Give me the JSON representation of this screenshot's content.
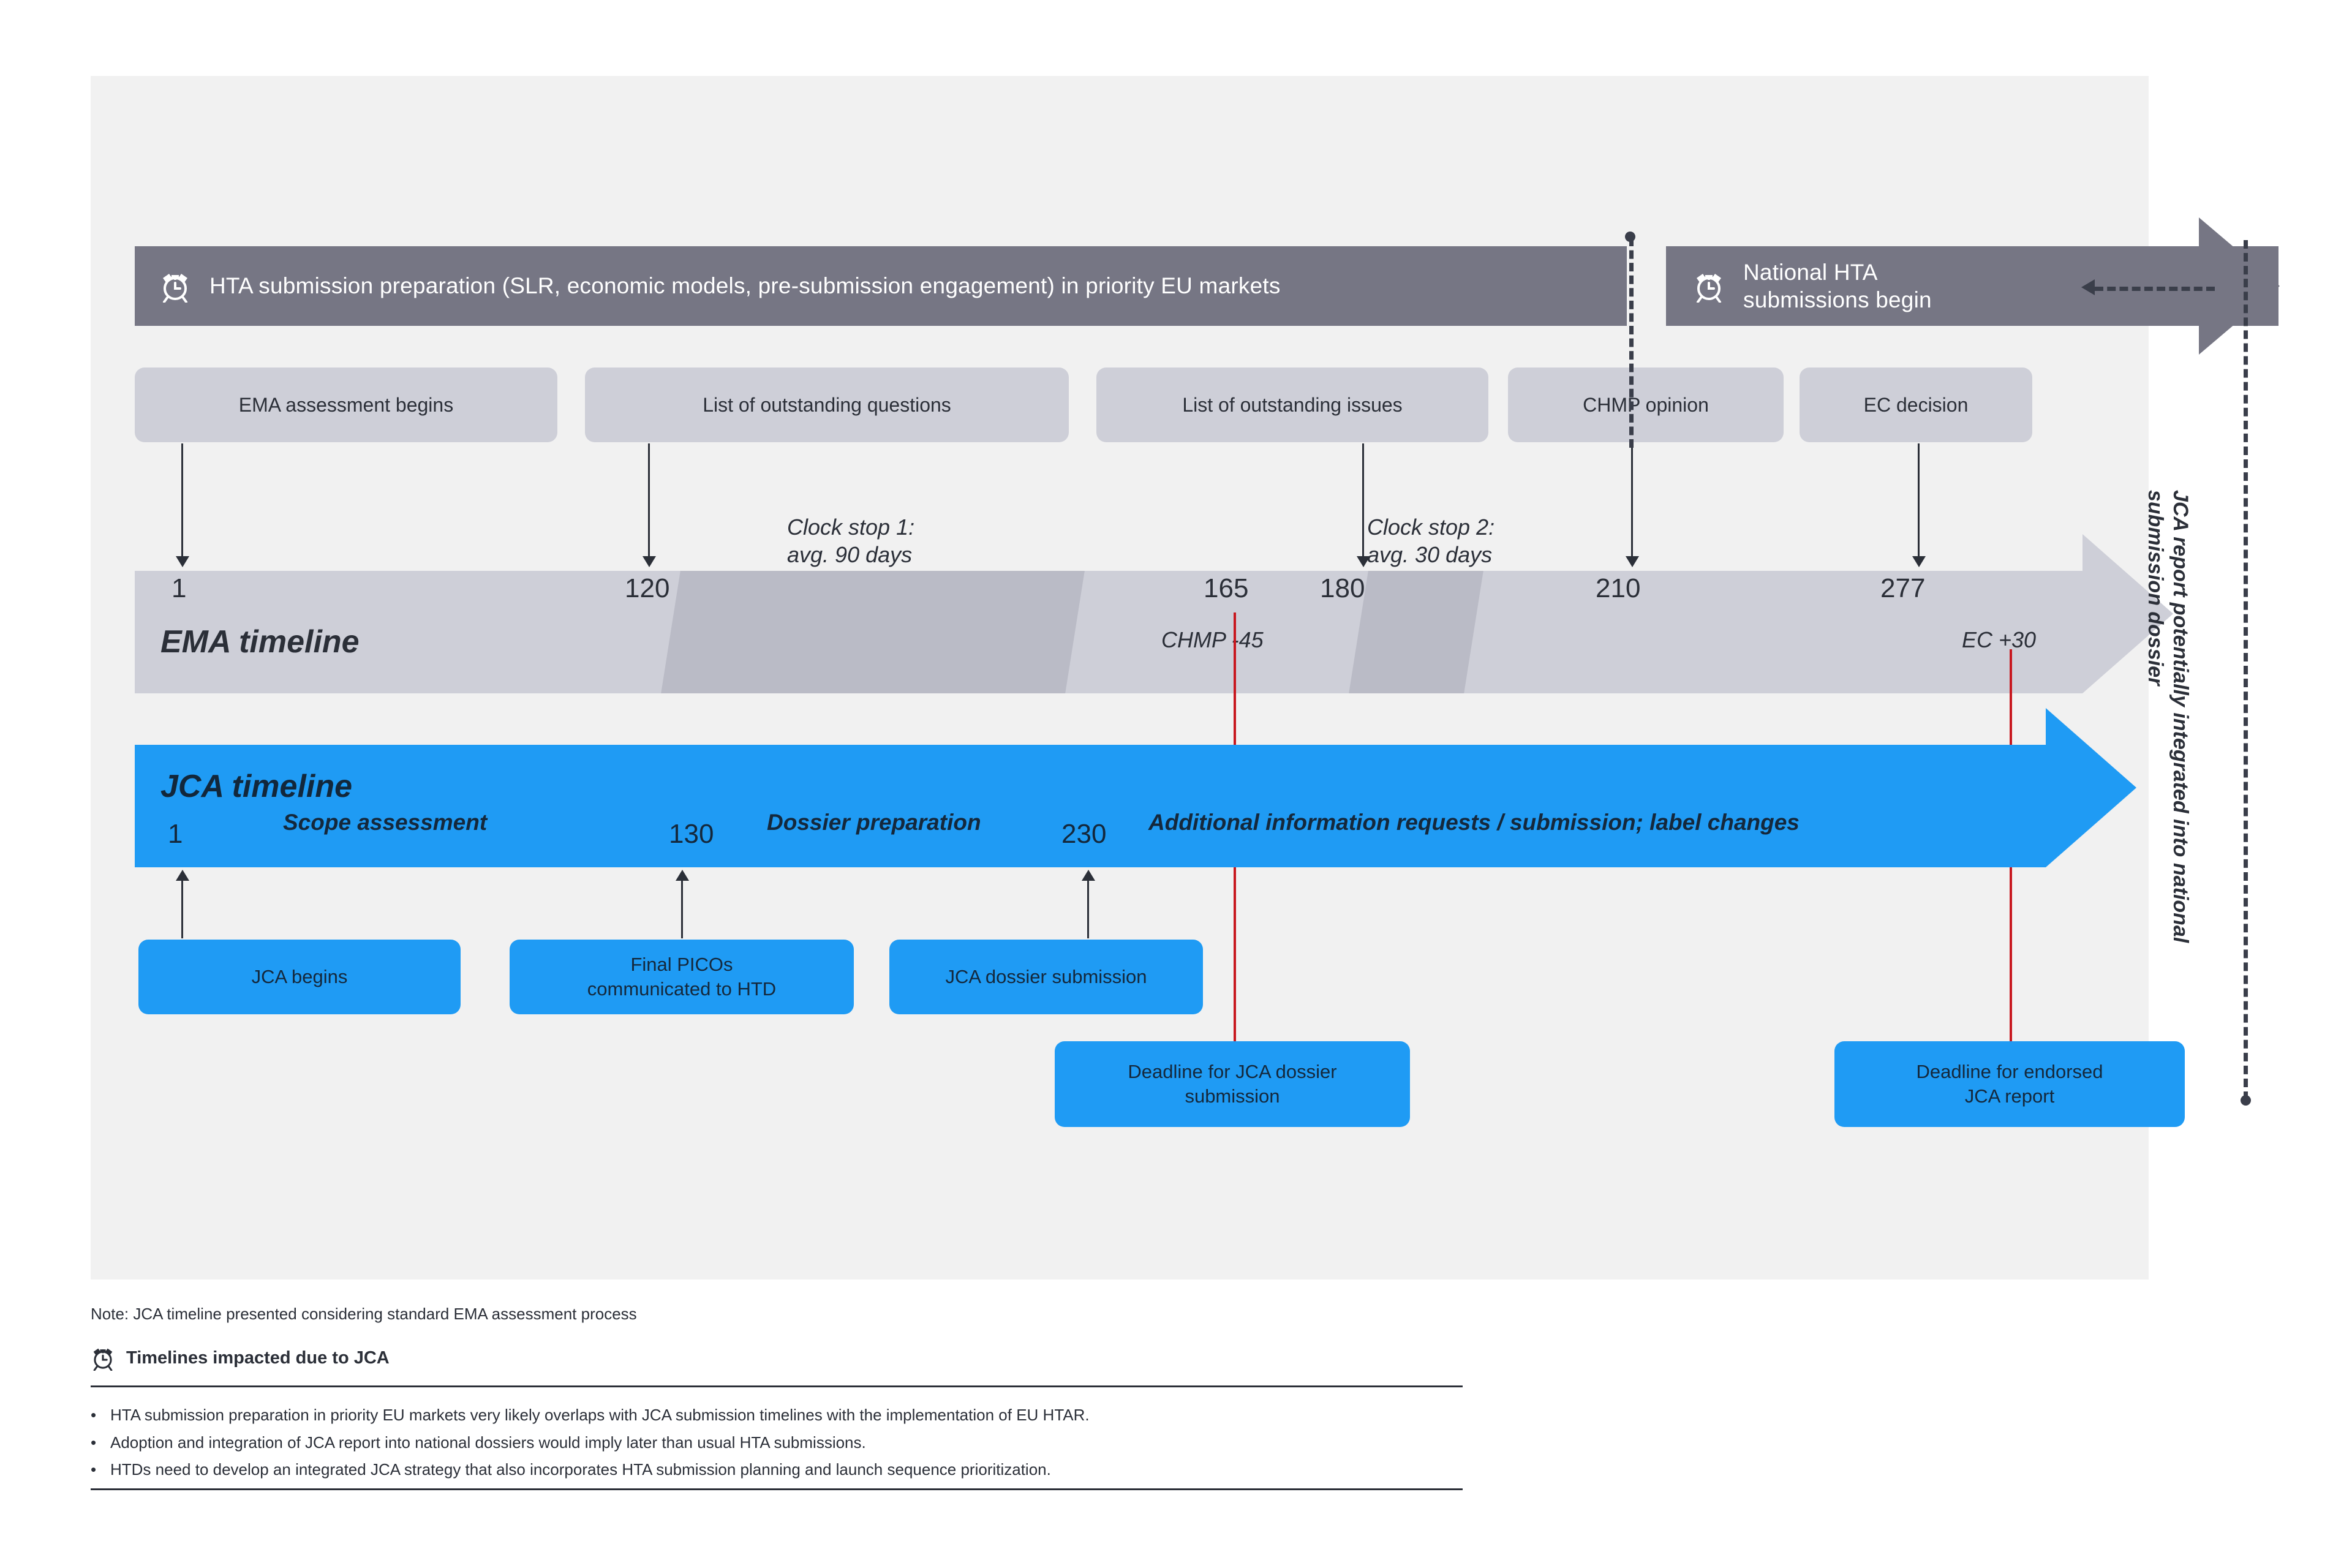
{
  "colors": {
    "panel_bg": "#f1f1f1",
    "dark_bar": "#767684",
    "grey_box": "#cecfd8",
    "grey_bar": "#cecfd8",
    "clock_stop": "#babbc6",
    "jca_blue": "#1f9bf4",
    "red_line": "#c8181f",
    "text_dark": "#2b2f38"
  },
  "top_bars": {
    "preparation": {
      "icon": "alarm-clock-icon",
      "label": "HTA submission preparation (SLR, economic models, pre-submission engagement) in priority EU markets"
    },
    "national": {
      "icon": "alarm-clock-icon",
      "line1": "National HTA",
      "line2": "submissions begin"
    }
  },
  "ema": {
    "title": "EMA timeline",
    "milestones": [
      {
        "label": "EMA assessment begins",
        "day": "1"
      },
      {
        "label": "List of outstanding questions",
        "day": "120"
      },
      {
        "label": "List of outstanding issues",
        "day": "180"
      },
      {
        "label": "CHMP opinion",
        "day": "210"
      },
      {
        "label": "EC decision",
        "day": "277"
      }
    ],
    "extra_days": [
      "165"
    ],
    "clock_stops": [
      {
        "line1": "Clock stop 1:",
        "line2": "avg. 90 days"
      },
      {
        "line1": "Clock stop 2:",
        "line2": "avg. 30 days"
      }
    ],
    "red_markers": [
      {
        "label": "CHMP -45"
      },
      {
        "label": "EC +30"
      }
    ]
  },
  "jca": {
    "title": "JCA timeline",
    "days": [
      "1",
      "130",
      "230"
    ],
    "phases": [
      "Scope assessment",
      "Dossier preparation",
      "Additional information requests / submission; label changes"
    ],
    "milestones": [
      {
        "line1": "JCA begins",
        "line2": ""
      },
      {
        "line1": "Final PICOs",
        "line2": "communicated to HTD"
      },
      {
        "line1": "JCA dossier submission",
        "line2": ""
      }
    ],
    "deadlines": [
      {
        "line1": "Deadline for JCA dossier",
        "line2": "submission"
      },
      {
        "line1": "Deadline for endorsed",
        "line2": "JCA report"
      }
    ]
  },
  "side_caption": "JCA report potentially integrated into national submission dossier",
  "footer": {
    "note": "Note: JCA timeline presented considering standard EMA assessment process",
    "legend_icon": "alarm-clock-icon",
    "legend_label": "Timelines impacted due to JCA",
    "bullets": [
      "HTA submission preparation in priority EU markets very likely overlaps with JCA submission timelines with the implementation of EU HTAR.",
      "Adoption and integration of JCA report into national dossiers would imply later than usual HTA submissions.",
      "HTDs need to develop an integrated JCA strategy that also incorporates HTA submission planning and launch sequence prioritization."
    ]
  }
}
